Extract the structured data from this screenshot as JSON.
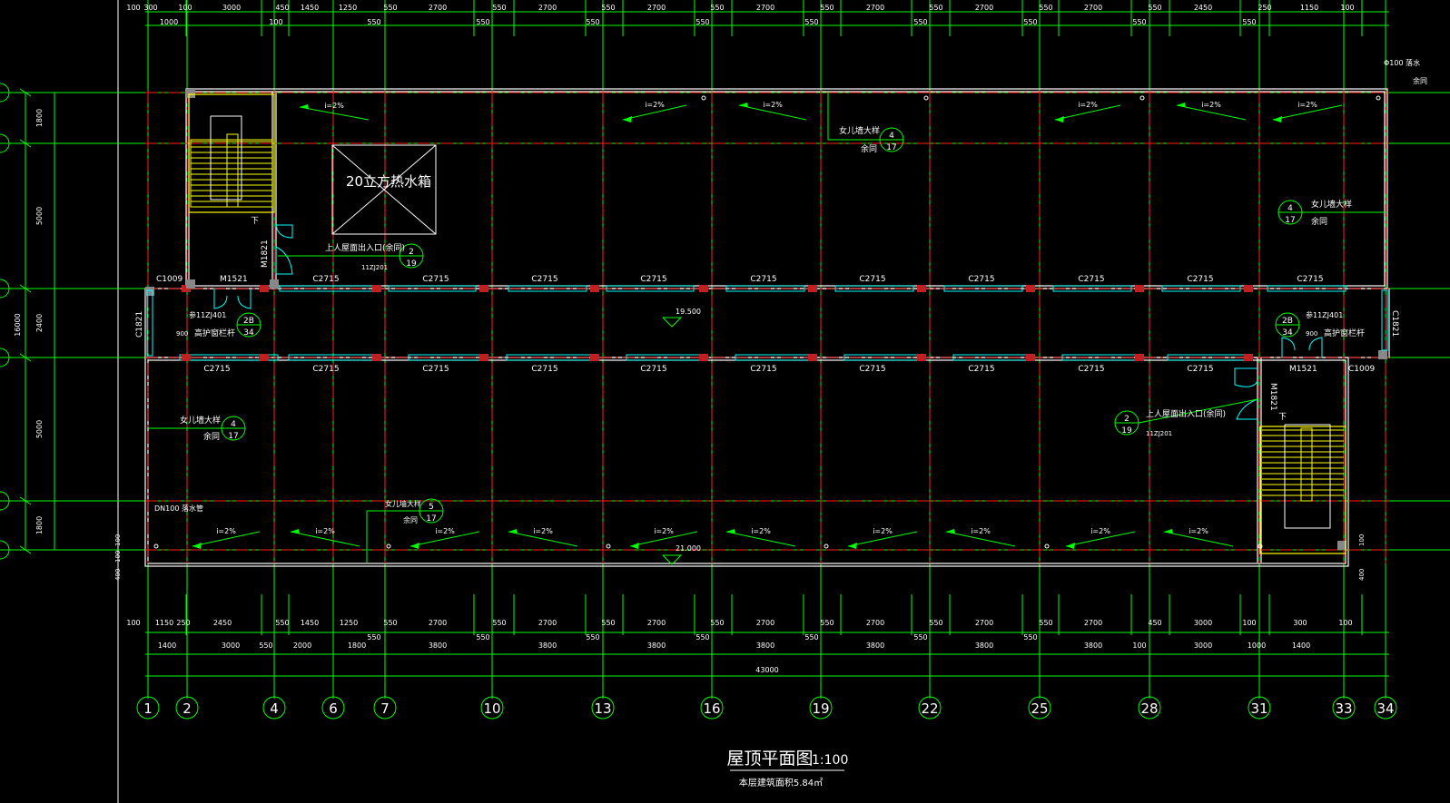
{
  "drawing": {
    "title": "屋顶平面图",
    "scale": "1:100",
    "area_note": "本层建筑面积5.84㎡",
    "tank_label": "20立方热水箱",
    "top_elevation": "19.500",
    "bottom_elevation": "21.000",
    "stair_down": "下",
    "slope": "i=2%",
    "downpipe": "DN100 落水管",
    "downpipe_top_a": "Φ100 落水",
    "downpipe_top_b": "余同",
    "exit_label": "上人屋面出入口(余同)",
    "exit_ref": "11ZJ201",
    "parapet_label": "女儿墙大样",
    "same_label": "余同",
    "rail_ref": "参11ZJ401",
    "rail_label": "高护窗栏杆",
    "rail_900": "900",
    "door_m1821": "M1821",
    "door_m1521": "M1521",
    "win_c1009": "C1009",
    "win_c1821": "C1821",
    "win_c2715": "C2715"
  },
  "axes": [
    "1",
    "2",
    "4",
    "6",
    "7",
    "10",
    "13",
    "16",
    "19",
    "22",
    "25",
    "28",
    "31",
    "33",
    "34"
  ],
  "dims_top_row1": [
    "100",
    "300",
    "100",
    "3000",
    "450",
    "1450",
    "1250",
    "550",
    "2700",
    "550",
    "2700",
    "550",
    "2700",
    "550",
    "2700",
    "550",
    "2700",
    "550",
    "2700",
    "550",
    "2700",
    "550",
    "2450",
    "250",
    "1150",
    "100"
  ],
  "dims_top_row2": [
    "1000",
    "100",
    "550",
    "550",
    "550",
    "550",
    "550",
    "550",
    "550",
    "550",
    "550"
  ],
  "dims_bottom_row1": [
    "100",
    "1150",
    "250",
    "2450",
    "550",
    "1450",
    "1250",
    "550",
    "2700",
    "550",
    "2700",
    "550",
    "2700",
    "550",
    "2700",
    "550",
    "2700",
    "550",
    "2700",
    "550",
    "2700",
    "450",
    "3000",
    "100",
    "300",
    "100"
  ],
  "dims_bottom_row2": [
    "1400",
    "3000",
    "550",
    "2000",
    "1800",
    "550",
    "3800",
    "550",
    "3800",
    "550",
    "3800",
    "550",
    "3800",
    "550",
    "3800",
    "550",
    "3800",
    "550",
    "3800",
    "100",
    "3000",
    "1000",
    "1400"
  ],
  "dims_bottom_total": "43000",
  "dims_left": [
    "1800",
    "5000",
    "2400",
    "5000",
    "1800"
  ],
  "dims_left_total": "16000",
  "dims_side_small": [
    "100",
    "100",
    "400"
  ],
  "bubbles": [
    {
      "top": "2",
      "bottom": "19"
    },
    {
      "top": "4",
      "bottom": "17"
    },
    {
      "top": "5",
      "bottom": "17"
    },
    {
      "top": "2B",
      "bottom": "34"
    }
  ]
}
